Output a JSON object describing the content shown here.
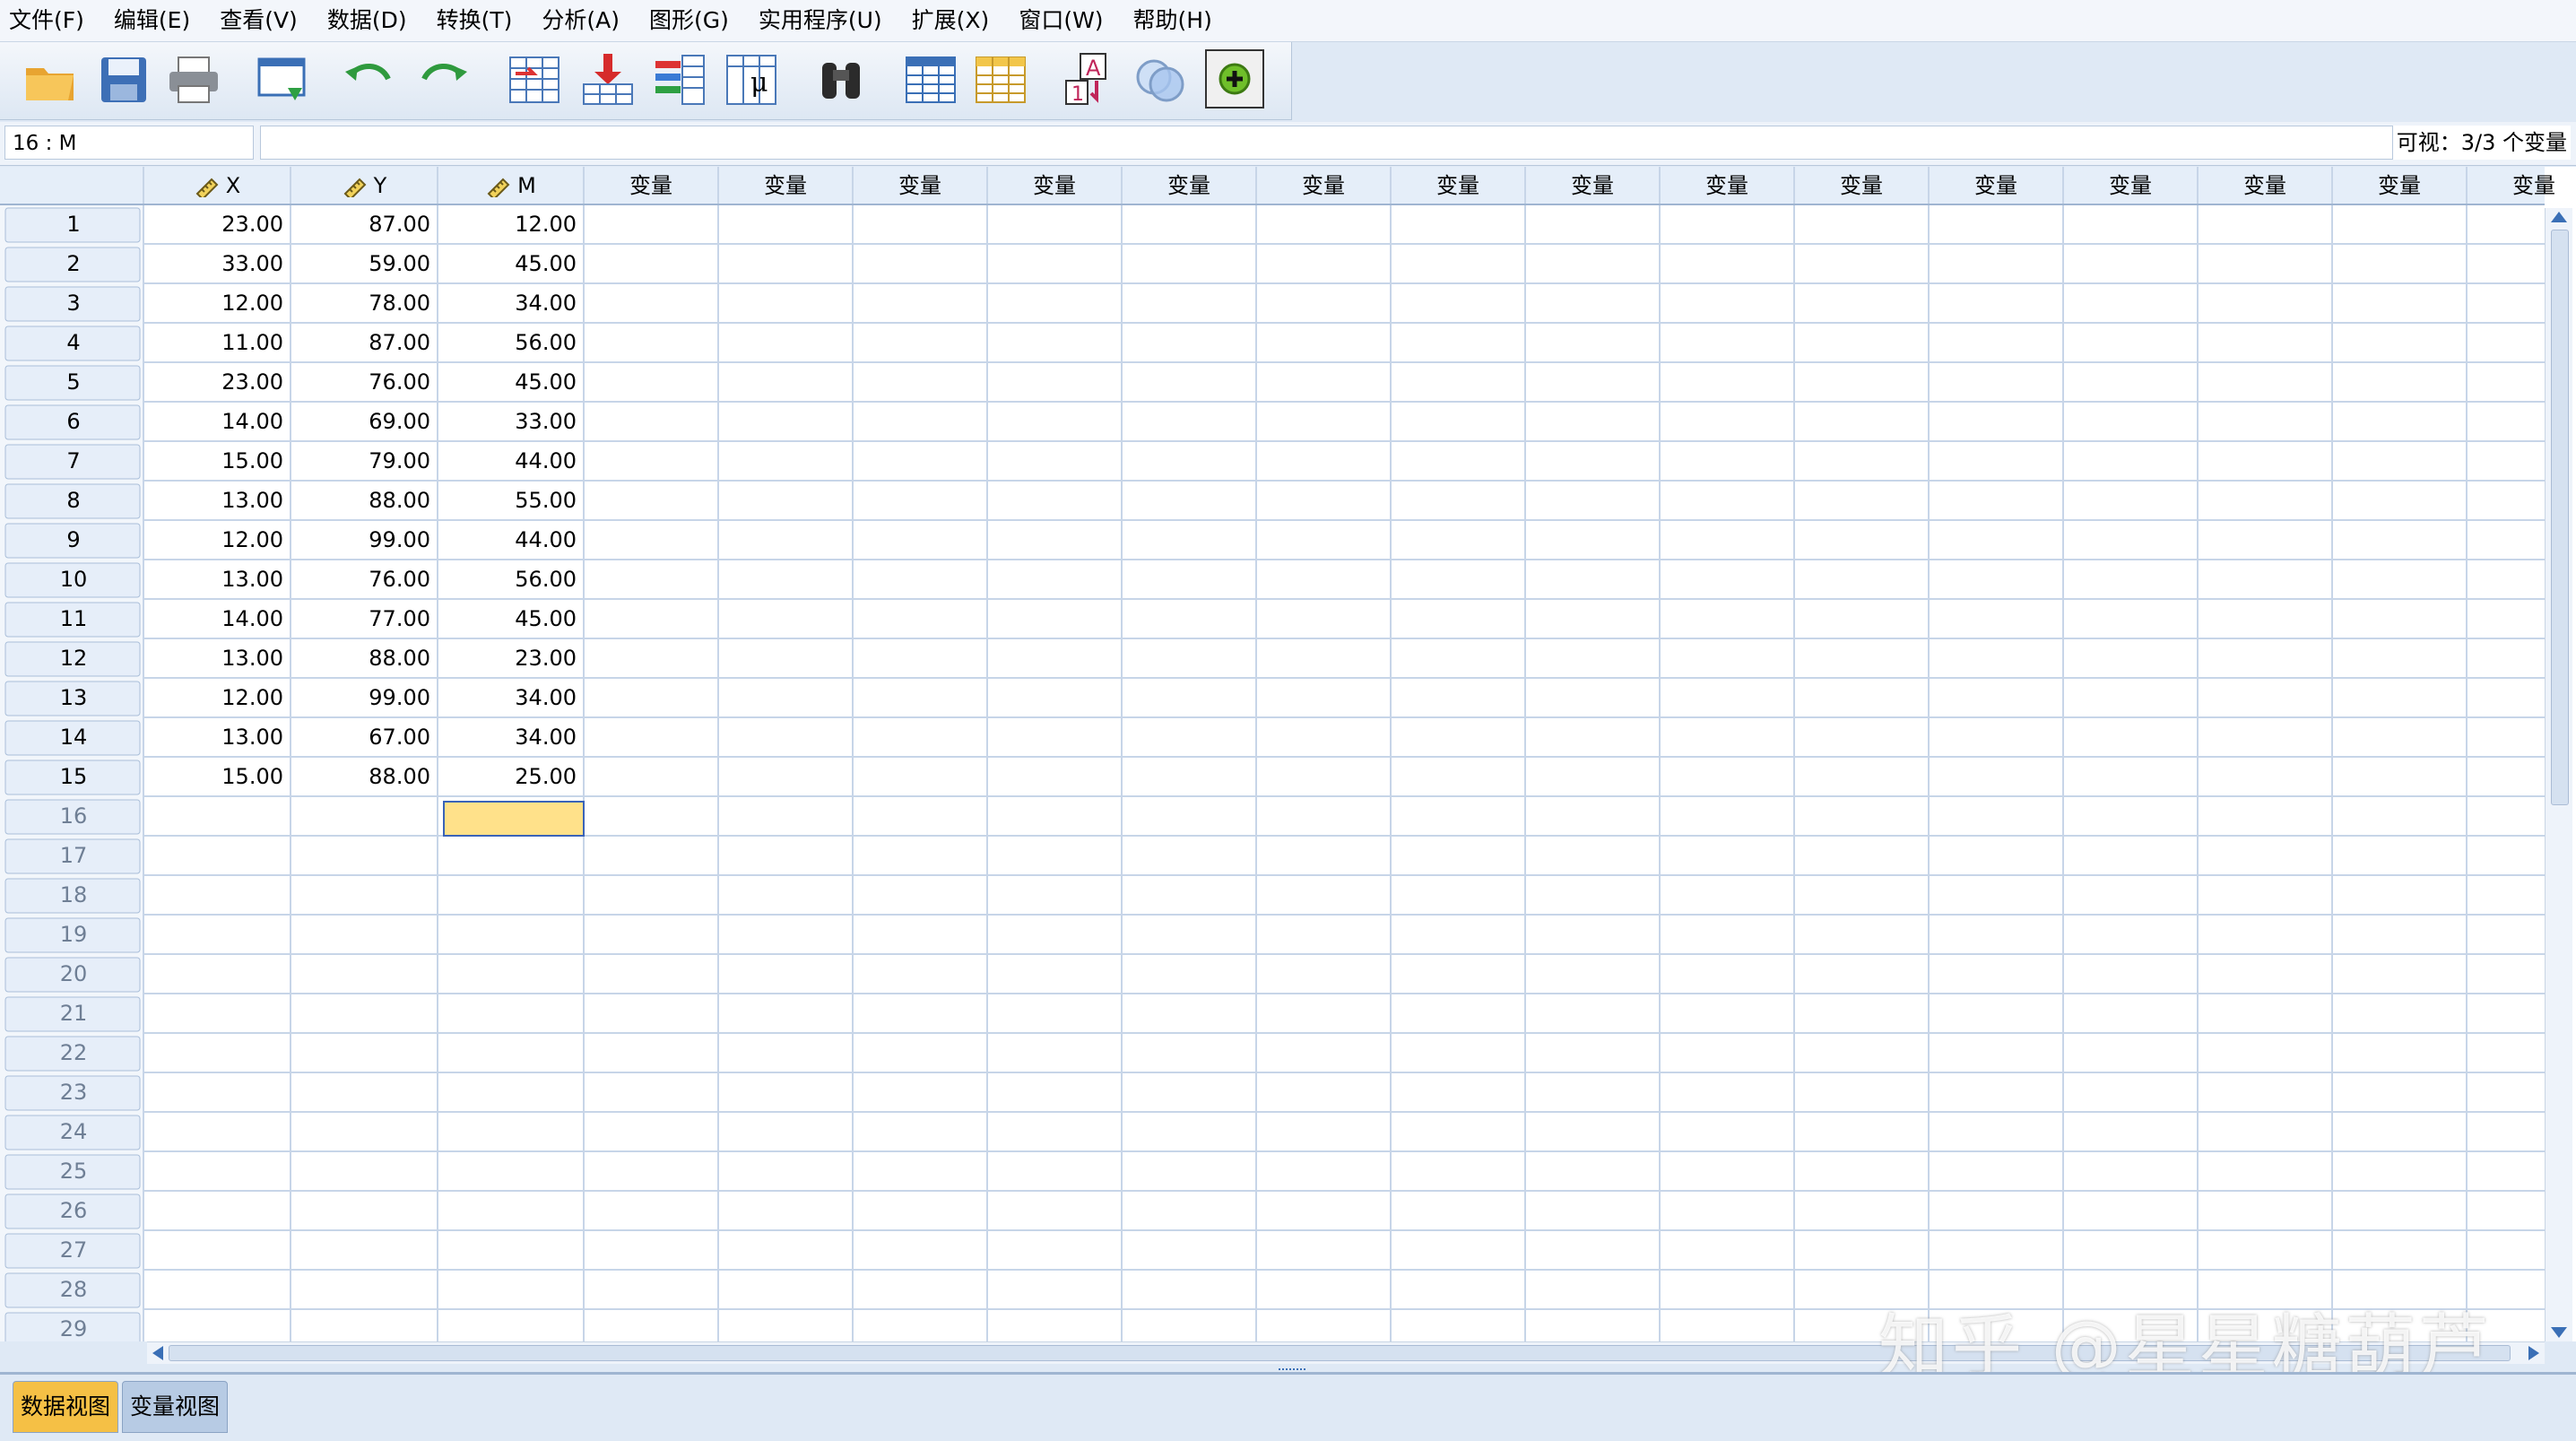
{
  "menu": [
    "文件(F)",
    "编辑(E)",
    "查看(V)",
    "数据(D)",
    "转换(T)",
    "分析(A)",
    "图形(G)",
    "实用程序(U)",
    "扩展(X)",
    "窗口(W)",
    "帮助(H)"
  ],
  "toolbar_icons": [
    "open-icon",
    "save-icon",
    "print-icon",
    "recall-dialog-icon",
    "undo-icon",
    "redo-icon",
    "goto-case-icon",
    "goto-variable-icon",
    "variables-icon",
    "descriptive-stats-icon",
    "find-icon",
    "insert-cases-icon",
    "insert-variable-icon",
    "value-labels-icon",
    "use-sets-icon",
    "customize-toolbar-icon"
  ],
  "info": {
    "cell_ref": "16 : M",
    "cell_value": "",
    "visible": "可视：3/3 个变量"
  },
  "grid": {
    "columns": [
      "X",
      "Y",
      "M"
    ],
    "empty_column_label": "变量",
    "rows": [
      [
        "23.00",
        "87.00",
        "12.00"
      ],
      [
        "33.00",
        "59.00",
        "45.00"
      ],
      [
        "12.00",
        "78.00",
        "34.00"
      ],
      [
        "11.00",
        "87.00",
        "56.00"
      ],
      [
        "23.00",
        "76.00",
        "45.00"
      ],
      [
        "14.00",
        "69.00",
        "33.00"
      ],
      [
        "15.00",
        "79.00",
        "44.00"
      ],
      [
        "13.00",
        "88.00",
        "55.00"
      ],
      [
        "12.00",
        "99.00",
        "44.00"
      ],
      [
        "13.00",
        "76.00",
        "56.00"
      ],
      [
        "14.00",
        "77.00",
        "45.00"
      ],
      [
        "13.00",
        "88.00",
        "23.00"
      ],
      [
        "12.00",
        "99.00",
        "34.00"
      ],
      [
        "13.00",
        "67.00",
        "34.00"
      ],
      [
        "15.00",
        "88.00",
        "25.00"
      ]
    ],
    "row_numbers": [
      "1",
      "2",
      "3",
      "4",
      "5",
      "6",
      "7",
      "8",
      "9",
      "10",
      "11",
      "12",
      "13",
      "14",
      "15",
      "16",
      "17",
      "18",
      "19",
      "20",
      "21",
      "22",
      "23",
      "24",
      "25",
      "26",
      "27",
      "28",
      "29"
    ]
  },
  "tabs": {
    "data_view": "数据视图",
    "variable_view": "变量视图"
  },
  "watermark": "知乎 @星星糖葫芦",
  "colors": {
    "header_bg": "#e5eef9",
    "grid_line": "#c7d5e8",
    "active_cell": "#ffe18a",
    "active_tab": "#f5c045"
  }
}
